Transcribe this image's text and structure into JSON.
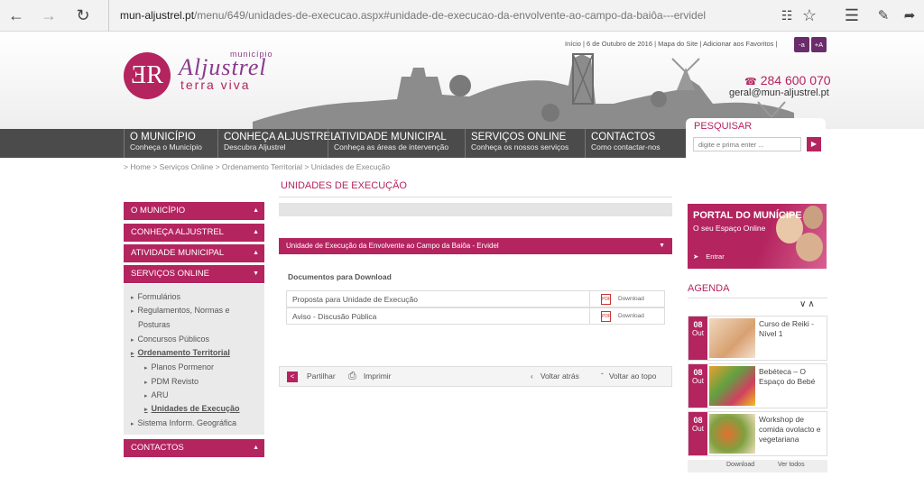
{
  "browser": {
    "url_host": "mun-aljustrel.pt",
    "url_path": "/menu/649/unidades-de-execucao.aspx#unidade-de-execucao-da-envolvente-ao-campo-da-baiôa---ervidel"
  },
  "header": {
    "top_links": "Início | 6 de Outubro de 2016 | Mapa do Site | Adicionar aos Favoritos |",
    "font_minus": "-a",
    "font_plus": "+A",
    "logo_municipio": "município",
    "logo_name": "Aljustrel",
    "logo_tagline": "terra viva",
    "phone": "284 600 070",
    "email": "geral@mun-aljustrel.pt"
  },
  "nav": [
    {
      "title": "O MUNICÍPIO",
      "subtitle": "Conheça o Município"
    },
    {
      "title": "CONHEÇA ALJUSTREL",
      "subtitle": "Descubra Aljustrel"
    },
    {
      "title": "ATIVIDADE MUNICIPAL",
      "subtitle": "Conheça as áreas de intervenção"
    },
    {
      "title": "SERVIÇOS ONLINE",
      "subtitle": "Conheça os nossos serviços"
    },
    {
      "title": "CONTACTOS",
      "subtitle": "Como contactar-nos"
    }
  ],
  "search": {
    "title": "PESQUISAR",
    "placeholder": "digite e prima enter ..."
  },
  "breadcrumb": "> Home > Serviços Online > Ordenamento Territorial > Unidades de Execução",
  "left_menu": {
    "bars": [
      "O MUNICÍPIO",
      "CONHEÇA ALJUSTREL",
      "ATIVIDADE MUNICIPAL",
      "SERVIÇOS ONLINE"
    ],
    "sub": {
      "formularios": "Formulários",
      "regulamentos_1": "Regulamentos, Normas e",
      "regulamentos_2": "Posturas",
      "concursos": "Concursos Públicos",
      "ordenamento": "Ordenamento Territorial",
      "planos": "Planos Pormenor",
      "pdm": "PDM Revisto",
      "aru": "ARU",
      "unidades": "Unidades de Execução",
      "sig": "Sistema Inform. Geográfica"
    },
    "contactos": "CONTACTOS"
  },
  "main": {
    "title": "UNIDADES DE EXECUÇÃO",
    "accordion_title": "Unidade de Execução da Envolvente ao Campo da Baiôa - Ervidel",
    "docs_heading": "Documentos para Download",
    "documents": [
      {
        "name": "Proposta para Unidade de Execução",
        "action": "Download"
      },
      {
        "name": "Aviso - Discusão Pública",
        "action": "Download"
      }
    ],
    "actions": {
      "share": "Partilhar",
      "print": "Imprimir",
      "back": "Voltar atrás",
      "top": "Voltar ao topo"
    }
  },
  "portal": {
    "title": "PORTAL DO MUNÍCIPE",
    "subtitle": "O seu Espaço Online",
    "enter": "Entrar"
  },
  "agenda": {
    "title": "AGENDA",
    "events": [
      {
        "day": "08",
        "month": "Out",
        "title": "Curso de Reiki - Nível 1"
      },
      {
        "day": "08",
        "month": "Out",
        "title": "Bebéteca – O Espaço do Bebé"
      },
      {
        "day": "08",
        "month": "Out",
        "title": "Workshop de comida ovolacto e vegetariana"
      }
    ],
    "download": "Download",
    "see_all": "Ver todos"
  }
}
